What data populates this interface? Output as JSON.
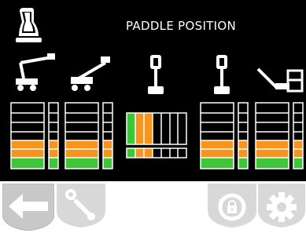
{
  "header": {
    "title": "PADDLE POSITION",
    "controller_icon": "joystick-controller-icon"
  },
  "machines": [
    {
      "icon": "articulated-boom-lift-icon"
    },
    {
      "icon": "telescopic-boom-lift-icon"
    },
    {
      "icon": "joystick-forward-back-icon"
    },
    {
      "icon": "joystick-forward-back-icon"
    },
    {
      "icon": "jib-platform-icon"
    }
  ],
  "colors": {
    "zone_green": "#3fc43a",
    "zone_orange": "#f7941d",
    "cell_border": "#ffffff",
    "background": "#000000",
    "button_inactive": "#d8d8d8"
  },
  "footer": {
    "buttons": [
      {
        "icon": "back-arrow-icon",
        "active": true
      },
      {
        "icon": "wrench-icon",
        "active": false
      },
      {
        "icon": "lock-rotate-icon",
        "active": false
      },
      {
        "icon": "gear-icon",
        "active": false
      }
    ]
  }
}
